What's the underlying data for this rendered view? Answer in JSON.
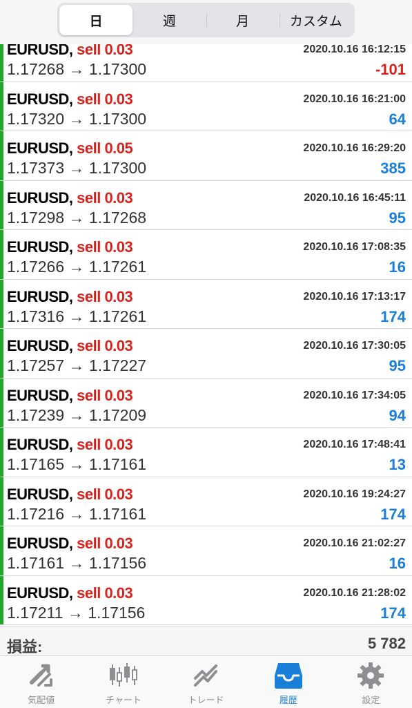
{
  "segments": [
    "日",
    "週",
    "月",
    "カスタム"
  ],
  "rows": [
    {
      "symbol": "EURUSD,",
      "side": "sell 0.03",
      "time": "2020.10.16 16:12:15",
      "prices": "1.17268 → 1.17300",
      "profit": "-101",
      "neg": true
    },
    {
      "symbol": "EURUSD,",
      "side": "sell 0.03",
      "time": "2020.10.16 16:21:00",
      "prices": "1.17320 → 1.17300",
      "profit": "64",
      "neg": false
    },
    {
      "symbol": "EURUSD,",
      "side": "sell 0.05",
      "time": "2020.10.16 16:29:20",
      "prices": "1.17373 → 1.17300",
      "profit": "385",
      "neg": false
    },
    {
      "symbol": "EURUSD,",
      "side": "sell 0.03",
      "time": "2020.10.16 16:45:11",
      "prices": "1.17298 → 1.17268",
      "profit": "95",
      "neg": false
    },
    {
      "symbol": "EURUSD,",
      "side": "sell 0.03",
      "time": "2020.10.16 17:08:35",
      "prices": "1.17266 → 1.17261",
      "profit": "16",
      "neg": false
    },
    {
      "symbol": "EURUSD,",
      "side": "sell 0.03",
      "time": "2020.10.16 17:13:17",
      "prices": "1.17316 → 1.17261",
      "profit": "174",
      "neg": false
    },
    {
      "symbol": "EURUSD,",
      "side": "sell 0.03",
      "time": "2020.10.16 17:30:05",
      "prices": "1.17257 → 1.17227",
      "profit": "95",
      "neg": false
    },
    {
      "symbol": "EURUSD,",
      "side": "sell 0.03",
      "time": "2020.10.16 17:34:05",
      "prices": "1.17239 → 1.17209",
      "profit": "94",
      "neg": false
    },
    {
      "symbol": "EURUSD,",
      "side": "sell 0.03",
      "time": "2020.10.16 17:48:41",
      "prices": "1.17165 → 1.17161",
      "profit": "13",
      "neg": false
    },
    {
      "symbol": "EURUSD,",
      "side": "sell 0.03",
      "time": "2020.10.16 19:24:27",
      "prices": "1.17216 → 1.17161",
      "profit": "174",
      "neg": false
    },
    {
      "symbol": "EURUSD,",
      "side": "sell 0.03",
      "time": "2020.10.16 21:02:27",
      "prices": "1.17161 → 1.17156",
      "profit": "16",
      "neg": false
    },
    {
      "symbol": "EURUSD,",
      "side": "sell 0.03",
      "time": "2020.10.16 21:28:02",
      "prices": "1.17211 → 1.17156",
      "profit": "174",
      "neg": false
    }
  ],
  "summary": {
    "label": "損益:",
    "value": "5 782"
  },
  "tabs": [
    {
      "label": "気配値",
      "icon": "quotes-icon"
    },
    {
      "label": "チャート",
      "icon": "candlestick-chart-icon"
    },
    {
      "label": "トレード",
      "icon": "trade-icon"
    },
    {
      "label": "履歴",
      "icon": "history-tray-icon"
    },
    {
      "label": "設定",
      "icon": "settings-gear-icon"
    }
  ],
  "colors": {
    "accent": "#1a7fd9",
    "sell": "#d7231d",
    "loss": "#d7231d",
    "profit": "#1a7fd9",
    "rowBar": "#1fa72c"
  }
}
